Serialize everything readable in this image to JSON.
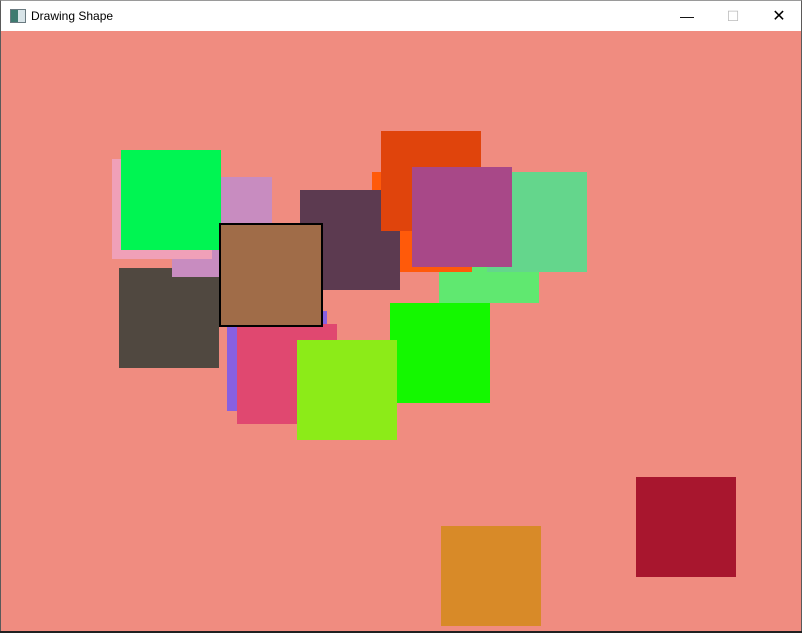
{
  "window": {
    "title": "Drawing Shape",
    "minimize_label": "—",
    "maximize_label": "☐",
    "close_label": "✕"
  },
  "canvas": {
    "background": "#f08c80"
  },
  "shapes": [
    {
      "kind": "square",
      "color": "#60e870"
    },
    {
      "kind": "square",
      "color": "#64d68c"
    },
    {
      "kind": "square",
      "color": "#ff5a0a"
    },
    {
      "kind": "square",
      "color": "#5c3a50"
    },
    {
      "kind": "square",
      "color": "#e0440c"
    },
    {
      "kind": "square",
      "color": "#a84888"
    },
    {
      "kind": "square",
      "color": "#14f800"
    },
    {
      "kind": "square",
      "color": "#504840"
    },
    {
      "kind": "square",
      "color": "#c88cc0"
    },
    {
      "kind": "square",
      "color": "#f0a0b8"
    },
    {
      "kind": "square",
      "color": "#00f552"
    },
    {
      "kind": "square",
      "color": "#8860e0"
    },
    {
      "kind": "square",
      "color": "#e04870"
    },
    {
      "kind": "square",
      "color": "#8ceb18"
    },
    {
      "kind": "square",
      "color": "#a06c48",
      "selected": true
    },
    {
      "kind": "square",
      "color": "#d88a28"
    },
    {
      "kind": "square",
      "color": "#a8162e"
    }
  ]
}
